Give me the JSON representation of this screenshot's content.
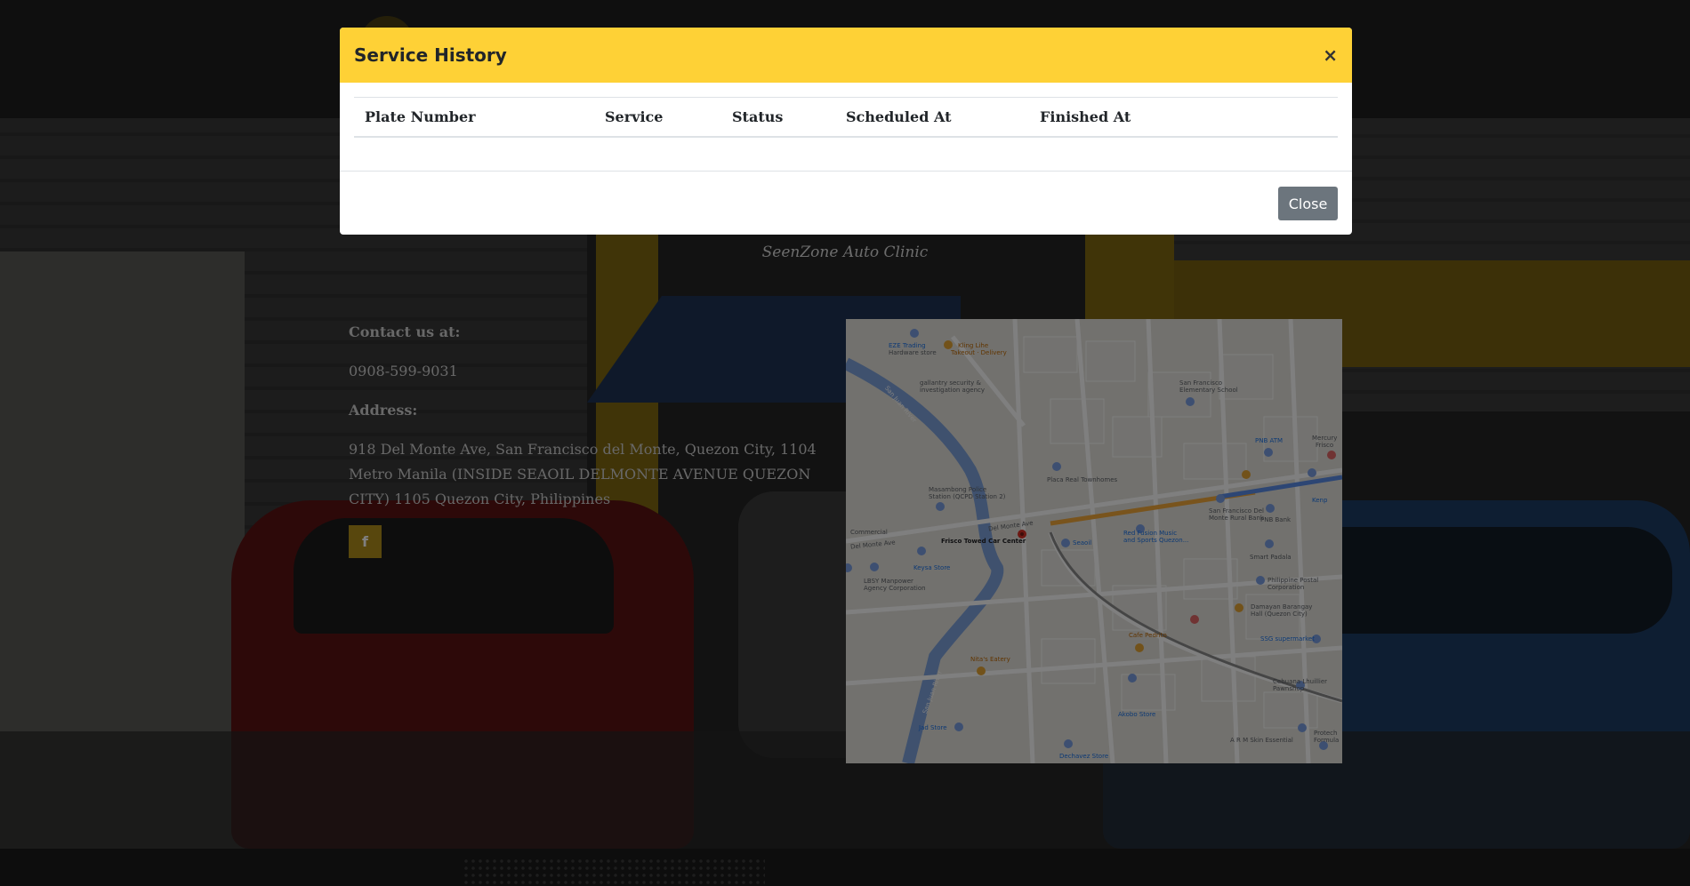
{
  "site": {
    "tagline": "SeenZone Auto Clinic",
    "contact": {
      "contact_label": "Contact us at:",
      "phone": "0908-599-9031",
      "address_label": "Address:",
      "address": "918 Del Monte Ave, San Francisco del Monte, Quezon City, 1104 Metro Manila (INSIDE SEAOIL DELMONTE AVENUE QUEZON CITY) 1105 Quezon City, Philippines",
      "facebook_icon": "f"
    },
    "map": {
      "labels": {
        "ezt": "EZE Trading",
        "ezt2": "Hardware store",
        "kling": "Kling Lihe",
        "kling2": "Takeout · Delivery",
        "galantry": "gallantry security &",
        "galantry2": "investigation agency",
        "sfes": "San Francisco",
        "sfes2": "Elementary School",
        "sanjuan_river1": "San Juan River",
        "sanjuan_river2": "San Juan River",
        "placa": "Placa Real Townhomes",
        "pnb": "PNB ATM",
        "mercury": "Mercury",
        "mercury2": "Frisco",
        "masambong": "Masambong Police",
        "masambong2": "Station (QCPD Station 2)",
        "delmonte": "Del Monte Ave",
        "delmonte2": "Del Monte Ave",
        "frisco_towed": "Frisco Towed Car Center",
        "seaoil": "Seaoil",
        "redfusion": "Red Fusion Music",
        "redfusion2": "and Sports Quezon...",
        "sfdm_rural": "San Francisco Del",
        "sfdm_rural2": "Monte Rural Bank",
        "pnb2": "PNB Bank",
        "smart": "Smart Padala",
        "commercial": "Commercial",
        "keysa": "Keysa Store",
        "lbsy": "LBSY Manpower",
        "lbsy2": "Agency Corporation",
        "phpostal": "Philippine Postal",
        "phpostal2": "Corporation",
        "damayan": "Damayan Barangay",
        "damayan2": "Hall (Quezon City)",
        "cafe": "Cafe Pedrito",
        "ssg": "SSG supermarket",
        "nitas": "Nita's Eatery",
        "sanjuan_road": "San Juan River",
        "cebuana": "Cebuana Lhuillier",
        "cebuana2": "Pawnshop",
        "akobo": "Akobo Store",
        "jad": "Jad Store",
        "dechavez": "Dechavez Store",
        "arm": "A R M Skin Essential",
        "protech": "Protech",
        "protech2": "Formula",
        "kenp": "Kenp"
      }
    }
  },
  "modal": {
    "title": "Service History",
    "close_x": "×",
    "columns": [
      "Plate Number",
      "Service",
      "Status",
      "Scheduled At",
      "Finished At"
    ],
    "rows": [],
    "close_button": "Close"
  }
}
